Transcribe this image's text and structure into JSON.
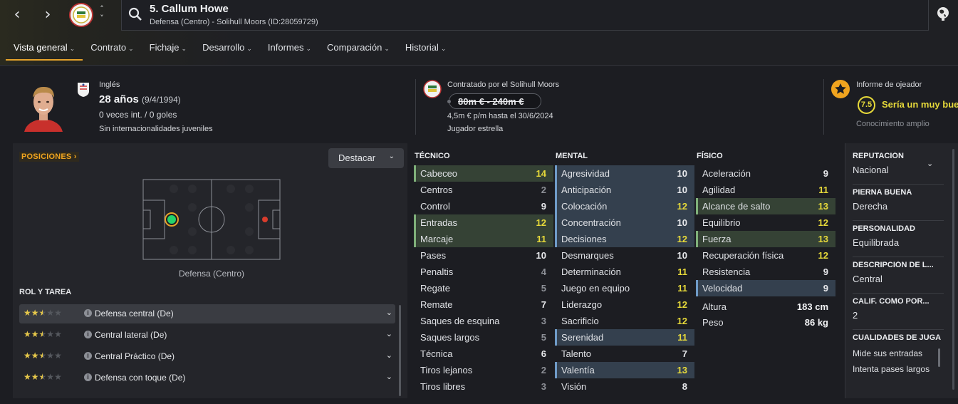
{
  "window": {
    "back_icon": "chevron-left-icon",
    "forward_icon": "chevron-right-icon",
    "globe_icon": "globe-icon"
  },
  "header": {
    "title": "5. Callum Howe",
    "subtitle": "Defensa (Centro) - Solihull Moors (ID:28059729)"
  },
  "tabs": [
    {
      "label": "Vista general",
      "active": true
    },
    {
      "label": "Contrato"
    },
    {
      "label": "Fichaje"
    },
    {
      "label": "Desarrollo"
    },
    {
      "label": "Informes"
    },
    {
      "label": "Comparación"
    },
    {
      "label": "Historial"
    }
  ],
  "profile": {
    "nationality": "Inglés",
    "age": "28 años",
    "dob": "(9/4/1994)",
    "caps": "0 veces int. / 0 goles",
    "youth": "Sin internacionalidades juveniles"
  },
  "contract": {
    "contracted_by": "Contratado por el Solihull Moors",
    "value": "80m € - 240m €",
    "wage": "4,5m € p/m hasta el 30/6/2024",
    "status": "Jugador estrella"
  },
  "scout": {
    "title": "Informe de ojeador",
    "rating": "7.5",
    "text": "Sería un muy bue",
    "knowledge": "Conocimiento amplio"
  },
  "positions": {
    "button": "POSICIONES",
    "highlight": "Destacar",
    "label": "Defensa (Centro)"
  },
  "roles": {
    "title": "ROL Y TAREA",
    "items": [
      {
        "name": "Defensa central (De)",
        "stars": 2.5,
        "selected": true
      },
      {
        "name": "Central lateral (De)",
        "stars": 2.5
      },
      {
        "name": "Central Práctico (De)",
        "stars": 2.5
      },
      {
        "name": "Defensa con toque (De)",
        "stars": 2.5
      }
    ]
  },
  "attributes": {
    "technical": {
      "title": "TÉCNICO",
      "items": [
        {
          "name": "Cabeceo",
          "value": "14",
          "hl": "g",
          "tone": "y"
        },
        {
          "name": "Centros",
          "value": "2",
          "tone": "dim"
        },
        {
          "name": "Control",
          "value": "9"
        },
        {
          "name": "Entradas",
          "value": "12",
          "hl": "g",
          "tone": "y"
        },
        {
          "name": "Marcaje",
          "value": "11",
          "hl": "g",
          "tone": "y"
        },
        {
          "name": "Pases",
          "value": "10"
        },
        {
          "name": "Penaltis",
          "value": "4",
          "tone": "dim"
        },
        {
          "name": "Regate",
          "value": "5",
          "tone": "dim"
        },
        {
          "name": "Remate",
          "value": "7"
        },
        {
          "name": "Saques de esquina",
          "value": "3",
          "tone": "dim"
        },
        {
          "name": "Saques largos",
          "value": "5",
          "tone": "dim"
        },
        {
          "name": "Técnica",
          "value": "6"
        },
        {
          "name": "Tiros lejanos",
          "value": "2",
          "tone": "dim"
        },
        {
          "name": "Tiros libres",
          "value": "3",
          "tone": "dim"
        }
      ]
    },
    "mental": {
      "title": "MENTAL",
      "items": [
        {
          "name": "Agresividad",
          "value": "10",
          "hl": "b"
        },
        {
          "name": "Anticipación",
          "value": "10",
          "hl": "b"
        },
        {
          "name": "Colocación",
          "value": "12",
          "hl": "b",
          "tone": "y"
        },
        {
          "name": "Concentración",
          "value": "10",
          "hl": "b"
        },
        {
          "name": "Decisiones",
          "value": "12",
          "hl": "b",
          "tone": "y"
        },
        {
          "name": "Desmarques",
          "value": "10"
        },
        {
          "name": "Determinación",
          "value": "11",
          "tone": "y"
        },
        {
          "name": "Juego en equipo",
          "value": "11",
          "tone": "y"
        },
        {
          "name": "Liderazgo",
          "value": "12",
          "tone": "y"
        },
        {
          "name": "Sacrificio",
          "value": "12",
          "tone": "y"
        },
        {
          "name": "Serenidad",
          "value": "11",
          "hl": "b",
          "tone": "y"
        },
        {
          "name": "Talento",
          "value": "7"
        },
        {
          "name": "Valentía",
          "value": "13",
          "hl": "b",
          "tone": "y"
        },
        {
          "name": "Visión",
          "value": "8"
        }
      ]
    },
    "physical": {
      "title": "FÍSICO",
      "items": [
        {
          "name": "Aceleración",
          "value": "9"
        },
        {
          "name": "Agilidad",
          "value": "11",
          "tone": "y"
        },
        {
          "name": "Alcance de salto",
          "value": "13",
          "hl": "g",
          "tone": "y"
        },
        {
          "name": "Equilibrio",
          "value": "12",
          "tone": "y"
        },
        {
          "name": "Fuerza",
          "value": "13",
          "hl": "g",
          "tone": "y"
        },
        {
          "name": "Recuperación física",
          "value": "12",
          "tone": "y"
        },
        {
          "name": "Resistencia",
          "value": "9"
        },
        {
          "name": "Velocidad",
          "value": "9",
          "hl": "b"
        }
      ],
      "height_label": "Altura",
      "height": "183 cm",
      "weight_label": "Peso",
      "weight": "86 kg"
    }
  },
  "details": {
    "reputation_label": "REPUTACIÓN",
    "reputation": "Nacional",
    "foot_label": "PIERNA BUENA",
    "foot": "Derecha",
    "personality_label": "PERSONALIDAD",
    "personality": "Equilibrada",
    "description_label": "DESCRIPCIÓN DE L...",
    "description": "Central",
    "gk_label": "CALIF. COMO POR...",
    "gk": "2",
    "qualities_label": "CUALIDADES DE JUGA",
    "qualities": [
      "Mide sus entradas",
      "Intenta pases largos"
    ]
  },
  "colors": {
    "accent": "#f0a41f",
    "good": "#e6d93a",
    "highlight_green": "#354235",
    "highlight_blue": "#34404e"
  }
}
